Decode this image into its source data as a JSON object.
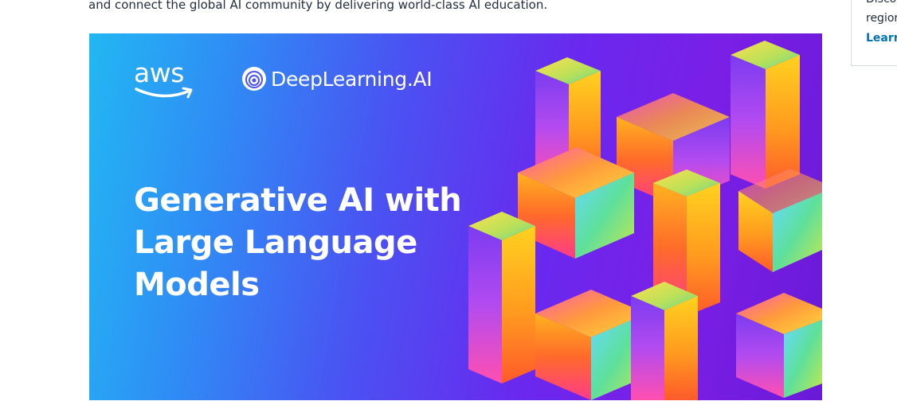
{
  "intro": {
    "text": "and connect the global AI community by delivering world-class AI education."
  },
  "side_card": {
    "line1": "Discov",
    "line2": "regior",
    "link": "Learn"
  },
  "banner": {
    "aws_logo_text": "aws",
    "dl_logo_text": "DeepLearning.AI",
    "headline": [
      "Generative AI with",
      "Large Language",
      "Models"
    ],
    "colors": {
      "gradient_start": "#22b7f2",
      "gradient_end": "#7a1fe6",
      "cube_pink": "#ff3fa4",
      "cube_orange": "#ff7a1a",
      "cube_yellow": "#ffd21f",
      "cube_green": "#59d98a"
    }
  }
}
